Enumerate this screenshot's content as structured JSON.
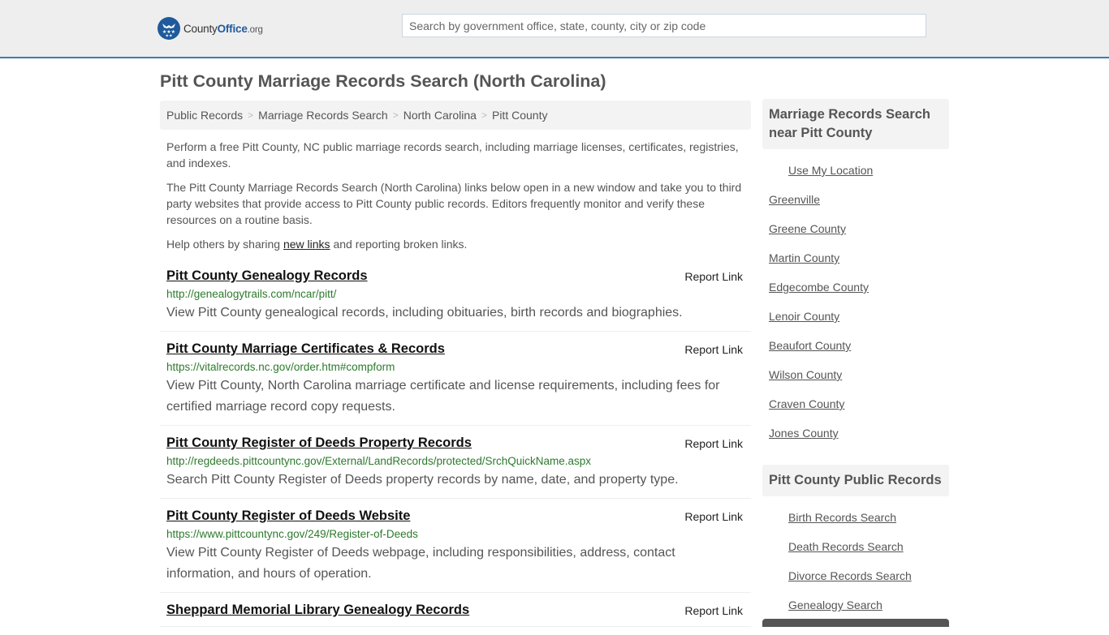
{
  "header": {
    "logo": {
      "county": "County",
      "office": "Office",
      "org": ".org"
    },
    "search_placeholder": "Search by government office, state, county, city or zip code"
  },
  "page_title": "Pitt County Marriage Records Search (North Carolina)",
  "breadcrumb": [
    "Public Records",
    "Marriage Records Search",
    "North Carolina",
    "Pitt County"
  ],
  "breadcrumb_separator": ">",
  "intro": {
    "p1": "Perform a free Pitt County, NC public marriage records search, including marriage licenses, certificates, registries, and indexes.",
    "p2": "The Pitt County Marriage Records Search (North Carolina) links below open in a new window and take you to third party websites that provide access to Pitt County public records. Editors frequently monitor and verify these resources on a routine basis.",
    "p3_before": "Help others by sharing ",
    "p3_link": "new links",
    "p3_after": " and reporting broken links."
  },
  "results": [
    {
      "title": "Pitt County Genealogy Records",
      "url": "http://genealogytrails.com/ncar/pitt/",
      "description": "View Pitt County genealogical records, including obituaries, birth records and biographies.",
      "report_label": "Report Link"
    },
    {
      "title": "Pitt County Marriage Certificates & Records",
      "url": "https://vitalrecords.nc.gov/order.htm#compform",
      "description": "View Pitt County, North Carolina marriage certificate and license requirements, including fees for certified marriage record copy requests.",
      "report_label": "Report Link"
    },
    {
      "title": "Pitt County Register of Deeds Property Records",
      "url": "http://regdeeds.pittcountync.gov/External/LandRecords/protected/SrchQuickName.aspx",
      "description": "Search Pitt County Register of Deeds property records by name, date, and property type.",
      "report_label": "Report Link"
    },
    {
      "title": "Pitt County Register of Deeds Website",
      "url": "https://www.pittcountync.gov/249/Register-of-Deeds",
      "description": "View Pitt County Register of Deeds webpage, including responsibilities, address, contact information, and hours of operation.",
      "report_label": "Report Link"
    },
    {
      "title": "Sheppard Memorial Library Genealogy Records",
      "url": "",
      "description": "",
      "report_label": "Report Link"
    }
  ],
  "sidebar": {
    "nearby": {
      "heading": "Marriage Records Search near Pitt County",
      "use_location": "Use My Location",
      "links": [
        "Greenville",
        "Greene County",
        "Martin County",
        "Edgecombe County",
        "Lenoir County",
        "Beaufort County",
        "Wilson County",
        "Craven County",
        "Jones County"
      ]
    },
    "public_records": {
      "heading": "Pitt County Public Records",
      "links": [
        "Birth Records Search",
        "Death Records Search",
        "Divorce Records Search",
        "Genealogy Search"
      ]
    }
  }
}
